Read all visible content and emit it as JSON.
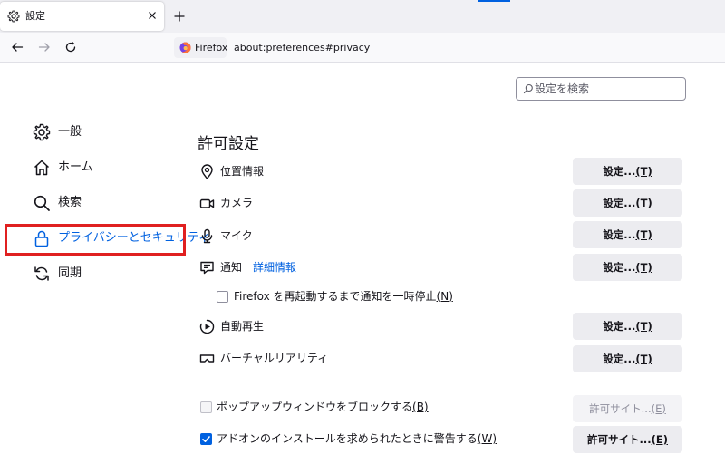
{
  "tabs": [
    {
      "title": "設定",
      "icon": "gear-icon"
    }
  ],
  "nav": {
    "identity_label": "Firefox",
    "url": "about:preferences#privacy"
  },
  "search": {
    "placeholder": "設定を検索"
  },
  "categories": [
    {
      "label": "一般",
      "icon": "gear-icon"
    },
    {
      "label": "ホーム",
      "icon": "home-icon"
    },
    {
      "label": "検索",
      "icon": "search-icon"
    },
    {
      "label": "プライバシーとセキュリティ",
      "icon": "lock-icon",
      "selected": true
    },
    {
      "label": "同期",
      "icon": "sync-icon"
    }
  ],
  "permissions": {
    "title": "許可設定",
    "items": [
      {
        "label": "位置情報",
        "icon": "location-icon",
        "button": "設定...",
        "accel": "(T)"
      },
      {
        "label": "カメラ",
        "icon": "camera-icon",
        "button": "設定...",
        "accel": "(T)"
      },
      {
        "label": "マイク",
        "icon": "microphone-icon",
        "button": "設定...",
        "accel": "(T)"
      },
      {
        "label": "通知",
        "icon": "notification-icon",
        "link": "詳細情報",
        "button": "設定...",
        "accel": "(T)"
      },
      {
        "label": "自動再生",
        "icon": "autoplay-icon",
        "button": "設定...",
        "accel": "(T)"
      },
      {
        "label": "バーチャルリアリティ",
        "icon": "vr-icon",
        "button": "設定...",
        "accel": "(T)"
      }
    ],
    "pause_notifications": {
      "label": "Firefox を再起動するまで通知を一時停止",
      "accel": "(N)",
      "checked": false
    },
    "block_popups": {
      "label": "ポップアップウィンドウをブロックする",
      "accel": "(B)",
      "checked": false,
      "button": "許可サイト...",
      "button_accel": "(E)",
      "disabled": true
    },
    "warn_addons": {
      "label": "アドオンのインストールを求められたときに警告する",
      "accel": "(W)",
      "checked": true,
      "button": "許可サイト...",
      "button_accel": "(E)"
    }
  },
  "colors": {
    "accent": "#0061e0",
    "highlight": "#e02020"
  }
}
